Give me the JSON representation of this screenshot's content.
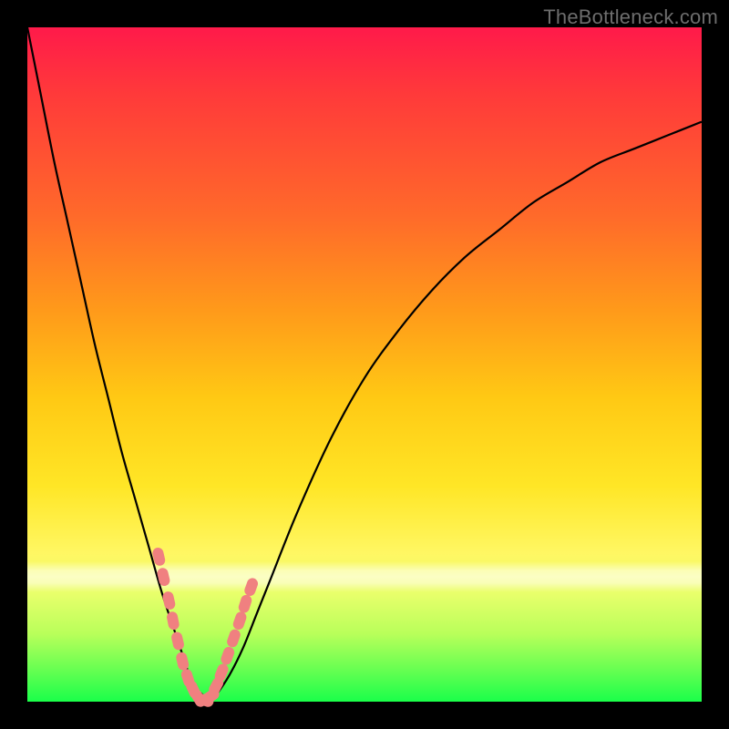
{
  "watermark": "TheBottleneck.com",
  "colors": {
    "gradient_top": "#ff1a4a",
    "gradient_mid": "#ffe626",
    "gradient_bottom": "#1aff4a",
    "curve": "#000000",
    "marker": "#f08080",
    "frame": "#000000"
  },
  "chart_data": {
    "type": "line",
    "title": "",
    "xlabel": "",
    "ylabel": "",
    "xlim": [
      0,
      100
    ],
    "ylim": [
      0,
      100
    ],
    "grid": false,
    "series": [
      {
        "name": "bottleneck-curve",
        "x": [
          0,
          2,
          4,
          6,
          8,
          10,
          12,
          14,
          16,
          18,
          20,
          22,
          23,
          24,
          25,
          26,
          27,
          28,
          30,
          32,
          34,
          36,
          40,
          45,
          50,
          55,
          60,
          65,
          70,
          75,
          80,
          85,
          90,
          95,
          100
        ],
        "y": [
          100,
          90,
          80,
          71,
          62,
          53,
          45,
          37,
          30,
          23,
          16,
          10,
          7,
          4,
          2,
          1,
          0,
          1,
          4,
          8,
          13,
          18,
          28,
          39,
          48,
          55,
          61,
          66,
          70,
          74,
          77,
          80,
          82,
          84,
          86
        ]
      }
    ],
    "markers": {
      "name": "highlighted-points",
      "shape": "rounded-capsule",
      "x": [
        19.5,
        20.2,
        21.0,
        21.6,
        22.3,
        23.0,
        23.8,
        24.6,
        25.4,
        26.3,
        27.2,
        28.0,
        28.8,
        29.7,
        30.6,
        31.5,
        32.3,
        33.2
      ],
      "y": [
        21.5,
        18.5,
        15.0,
        12.0,
        9.0,
        6.0,
        3.5,
        1.8,
        0.5,
        0.2,
        0.8,
        2.3,
        4.3,
        6.8,
        9.4,
        12.0,
        14.5,
        17.0
      ]
    }
  }
}
